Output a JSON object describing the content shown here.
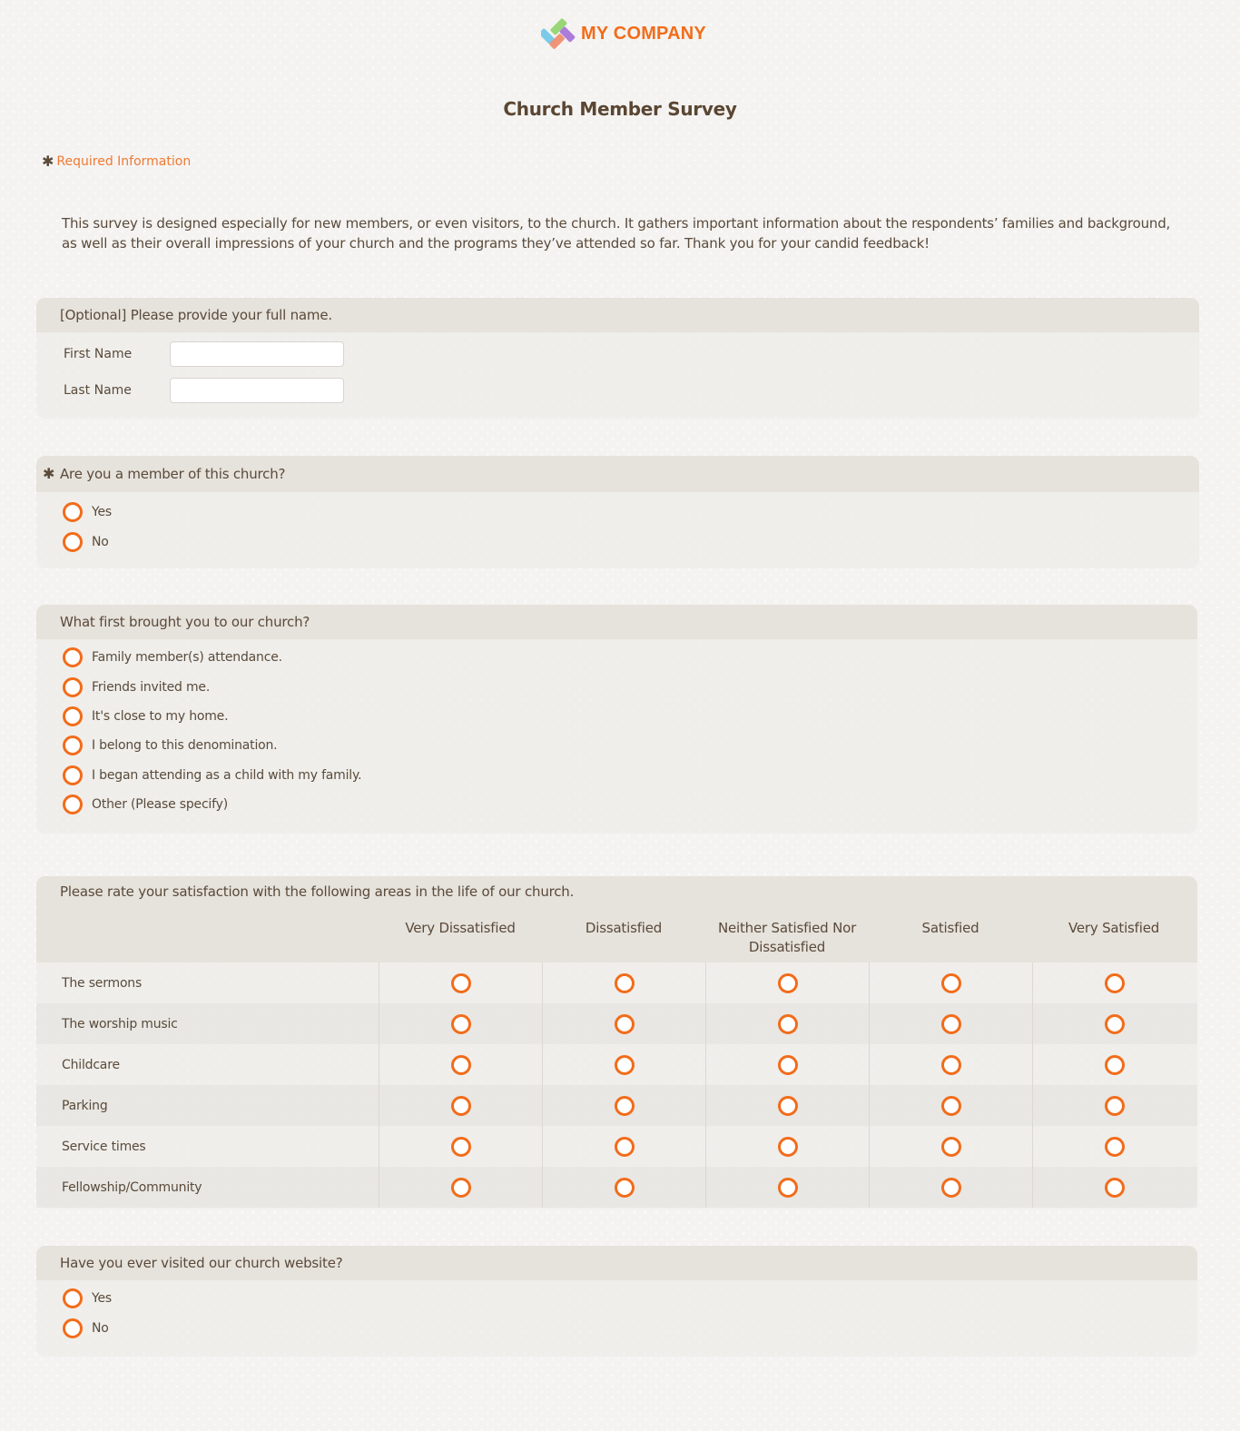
{
  "brand": {
    "name": "MY COMPANY",
    "logo_icon": "diamond-logo-icon",
    "accent_color": "#f26c1a"
  },
  "survey": {
    "title": "Church Member Survey",
    "required_note": "Required Information",
    "required_marker": "✱",
    "intro": "This survey is designed especially for new members, or even visitors, to the church. It gathers important information about the respondents’ families and background, as well as their overall impressions of your church and the programs they’ve attended so far. Thank you for your candid feedback!"
  },
  "name_question": {
    "label": "[Optional] Please provide your full name.",
    "fields": [
      {
        "label": "First Name",
        "value": "",
        "placeholder": ""
      },
      {
        "label": "Last Name",
        "value": "",
        "placeholder": ""
      }
    ]
  },
  "member_question": {
    "label": "Are you a member of this church?",
    "required": true,
    "options": [
      "Yes",
      "No"
    ]
  },
  "brought_question": {
    "label": "What first brought you to our church?",
    "options": [
      "Family member(s) attendance.",
      "Friends invited me.",
      "It's close to my home.",
      "I belong to this denomination.",
      "I began attending as a child with my family.",
      "Other (Please specify)"
    ]
  },
  "satisfaction_question": {
    "label": "Please rate your satisfaction with the following areas in the life of our church.",
    "columns": [
      "Very Dissatisfied",
      "Dissatisfied",
      "Neither Satisfied Nor Dissatisfied",
      "Satisfied",
      "Very Satisfied"
    ],
    "rows": [
      "The sermons",
      "The worship music",
      "Childcare",
      "Parking",
      "Service times",
      "Fellowship/Community"
    ]
  },
  "website_question": {
    "label": "Have you ever visited our church website?",
    "options": [
      "Yes",
      "No"
    ]
  }
}
